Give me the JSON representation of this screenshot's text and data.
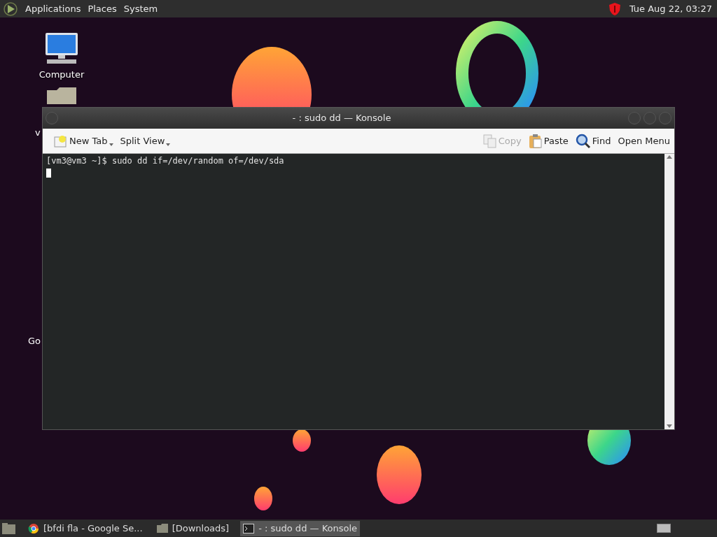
{
  "top_panel": {
    "menus": [
      "Applications",
      "Places",
      "System"
    ],
    "clock": "Tue Aug 22, 03:27"
  },
  "desktop_icons": [
    {
      "label": "Computer",
      "kind": "computer"
    },
    {
      "label": "v",
      "kind": "folder"
    },
    {
      "label": "Go",
      "kind": "hidden"
    }
  ],
  "window": {
    "title": "- : sudo dd — Konsole",
    "toolbar": [
      {
        "label": "New Tab",
        "kind": "new-tab",
        "disabled": false,
        "dropdown": true
      },
      {
        "label": "Split View",
        "kind": "split",
        "disabled": false,
        "dropdown": true
      },
      {
        "label": "Copy",
        "kind": "copy",
        "disabled": true,
        "dropdown": false
      },
      {
        "label": "Paste",
        "kind": "paste",
        "disabled": false,
        "dropdown": false
      },
      {
        "label": "Find",
        "kind": "find",
        "disabled": false,
        "dropdown": false
      },
      {
        "label": "Open Menu",
        "kind": "menu",
        "disabled": false,
        "dropdown": false
      }
    ],
    "terminal_lines": [
      "[vm3@vm3 ~]$ sudo dd if=/dev/random of=/dev/sda"
    ]
  },
  "taskbar": [
    {
      "label": "[bfdi fla - Google Se...",
      "kind": "browser",
      "selected": false
    },
    {
      "label": "[Downloads]",
      "kind": "folder",
      "selected": false
    },
    {
      "label": "- : sudo dd — Konsole",
      "kind": "terminal",
      "selected": true
    }
  ]
}
